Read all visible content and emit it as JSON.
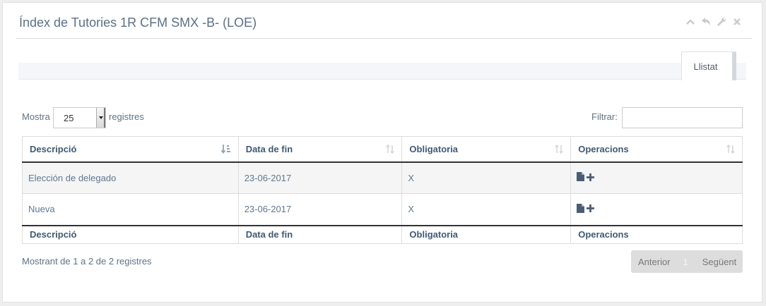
{
  "widget": {
    "title": "Índex de Tutories 1R CFM SMX -B- (LOE)"
  },
  "toolbar": {
    "icons": [
      "chevron-up-icon",
      "reply-icon",
      "wrench-icon",
      "close-icon"
    ]
  },
  "tabs": [
    {
      "label": "Llistat",
      "active": true
    }
  ],
  "length": {
    "prefix": "Mostra",
    "value": "25",
    "suffix": "registres"
  },
  "filter": {
    "label": "Filtrar:",
    "value": ""
  },
  "table": {
    "columns": [
      "Descripció",
      "Data de fin",
      "Obligatoria",
      "Operacions"
    ],
    "rows": [
      {
        "descripcio": "Elección de delegado",
        "data_fin": "23-06-2017",
        "obligatoria": "X",
        "operacions": [
          "document-icon",
          "plus-icon"
        ]
      },
      {
        "descripcio": "Nueva",
        "data_fin": "23-06-2017",
        "obligatoria": "X",
        "operacions": [
          "document-icon",
          "plus-icon"
        ]
      }
    ]
  },
  "summary": "Mostrant de 1 a 2 de 2 registres",
  "pagination": {
    "previous": "Anterior",
    "current": "1",
    "next": "Següent"
  },
  "colors": {
    "title": "#5a7088",
    "header_text": "#3f5a74",
    "cell_text": "#5f7890",
    "icon": "#4a5d73",
    "pager_bg": "#dddddd"
  }
}
